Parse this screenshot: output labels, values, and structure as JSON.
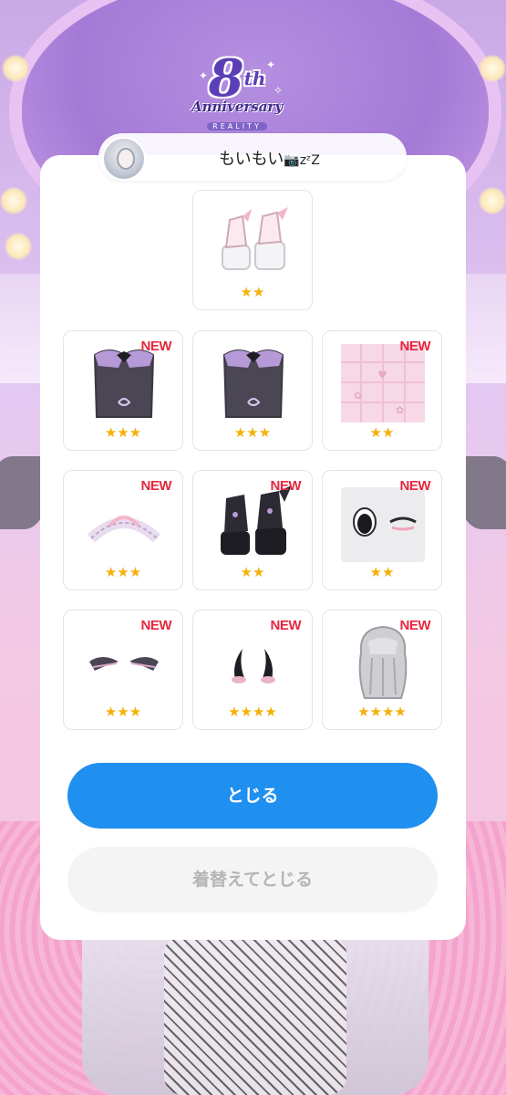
{
  "logo": {
    "number": "8",
    "suffix": "th",
    "title": "Anniversary",
    "subtitle": "REALITY"
  },
  "user": {
    "name": "もいもい",
    "emoji": "📷zᶻZ"
  },
  "items": [
    {
      "stars": "★★",
      "is_new": false,
      "new_label": "",
      "icon": "platform-boots-icon"
    },
    {
      "stars": "★★★",
      "is_new": true,
      "new_label": "NEW",
      "icon": "corset-top-icon"
    },
    {
      "stars": "★★★",
      "is_new": false,
      "new_label": "",
      "icon": "corset-top-icon"
    },
    {
      "stars": "★★",
      "is_new": true,
      "new_label": "NEW",
      "icon": "quilted-background-icon"
    },
    {
      "stars": "★★★",
      "is_new": true,
      "new_label": "NEW",
      "icon": "frill-headband-icon"
    },
    {
      "stars": "★★",
      "is_new": true,
      "new_label": "NEW",
      "icon": "black-platform-boots-icon"
    },
    {
      "stars": "★★",
      "is_new": true,
      "new_label": "NEW",
      "icon": "wink-eyes-icon"
    },
    {
      "stars": "★★★",
      "is_new": true,
      "new_label": "NEW",
      "icon": "small-wings-icon"
    },
    {
      "stars": "★★★★",
      "is_new": true,
      "new_label": "NEW",
      "icon": "demon-horns-icon"
    },
    {
      "stars": "★★★★",
      "is_new": true,
      "new_label": "NEW",
      "icon": "long-hair-icon"
    }
  ],
  "buttons": {
    "close": "とじる",
    "dress_and_close": "着替えてとじる"
  },
  "colors": {
    "primary_button": "#1f8ff0",
    "new_badge": "#e6273e",
    "star": "#f5b10a"
  }
}
